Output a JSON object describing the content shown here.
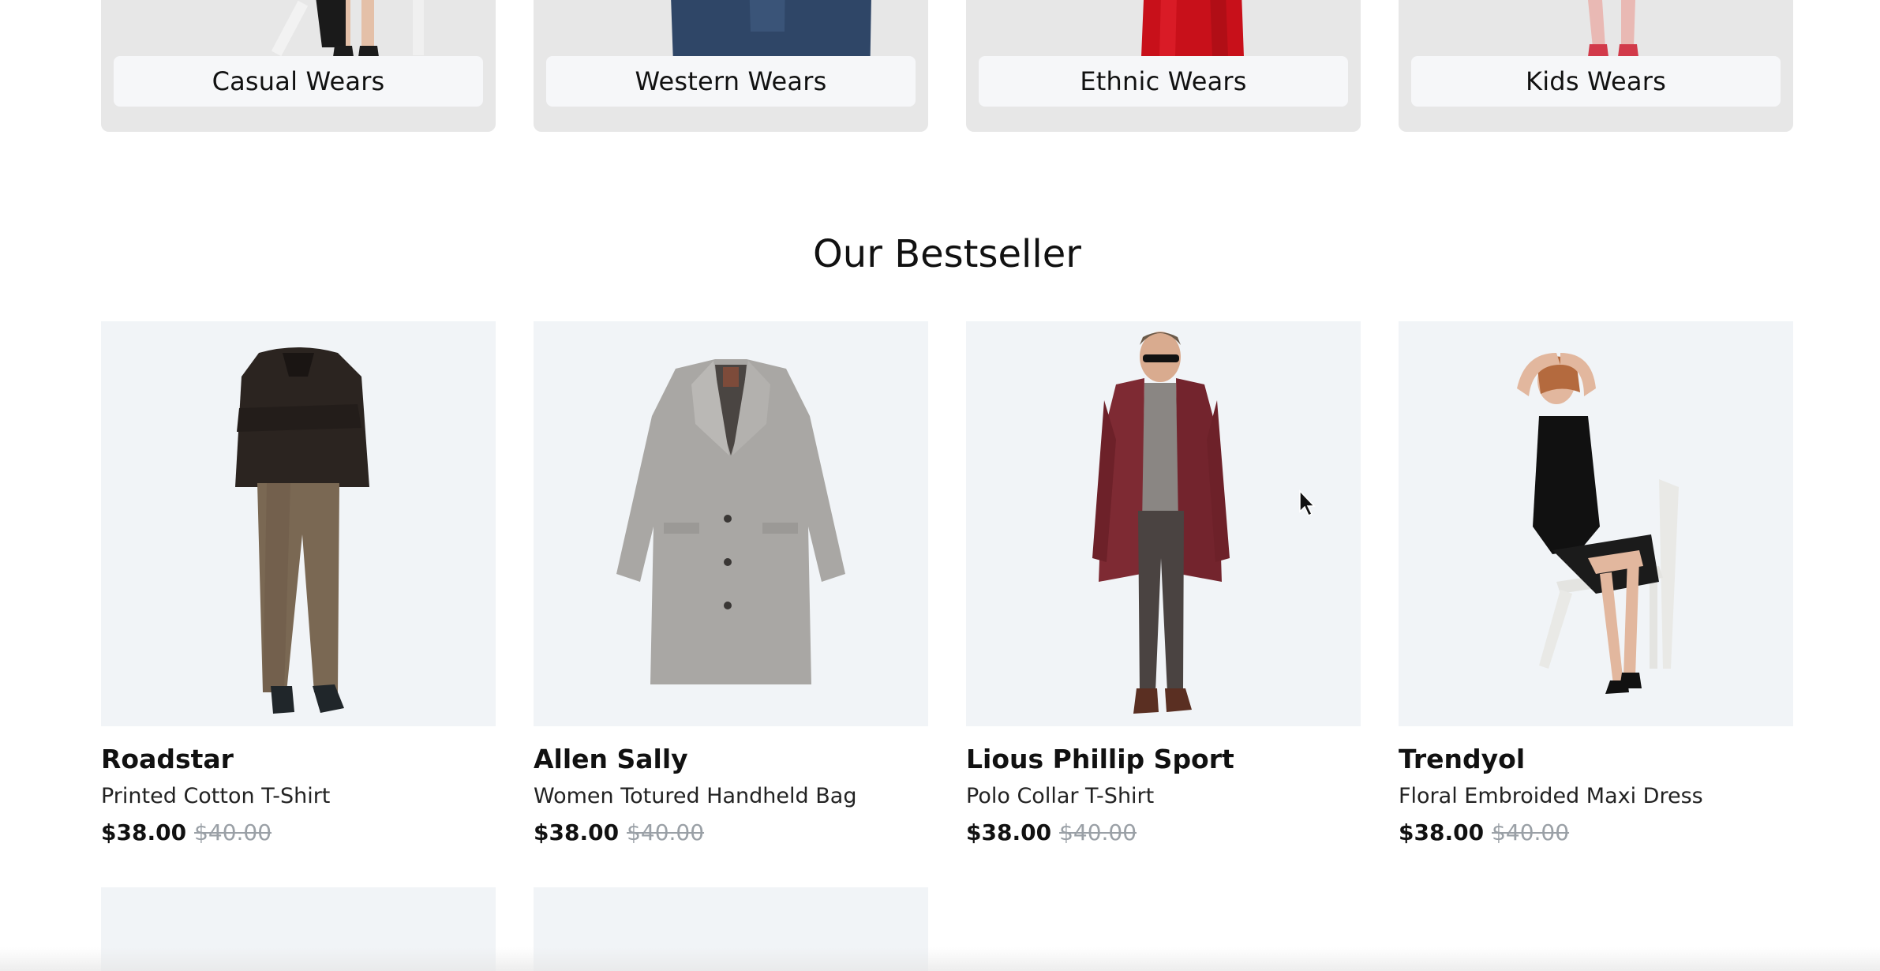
{
  "categories": [
    {
      "label": "Casual Wears"
    },
    {
      "label": "Western Wears"
    },
    {
      "label": "Ethnic Wears"
    },
    {
      "label": "Kids Wears"
    }
  ],
  "bestseller": {
    "title": "Our Bestseller",
    "products": [
      {
        "brand": "Roadstar",
        "name": "Printed Cotton T-Shirt",
        "price": "$38.00",
        "old_price": "$40.00"
      },
      {
        "brand": "Allen Sally",
        "name": "Women Totured Handheld Bag",
        "price": "$38.00",
        "old_price": "$40.00"
      },
      {
        "brand": "Lious Phillip Sport",
        "name": "Polo Collar T-Shirt",
        "price": "$38.00",
        "old_price": "$40.00"
      },
      {
        "brand": "Trendyol",
        "name": "Floral Embroided Maxi Dress",
        "price": "$38.00",
        "old_price": "$40.00"
      }
    ]
  },
  "colors": {
    "category_card_bg": "#e7e7e7",
    "label_bg": "#f6f7f9",
    "product_image_bg": "#f1f4f7",
    "old_price": "#9aa0a6"
  }
}
